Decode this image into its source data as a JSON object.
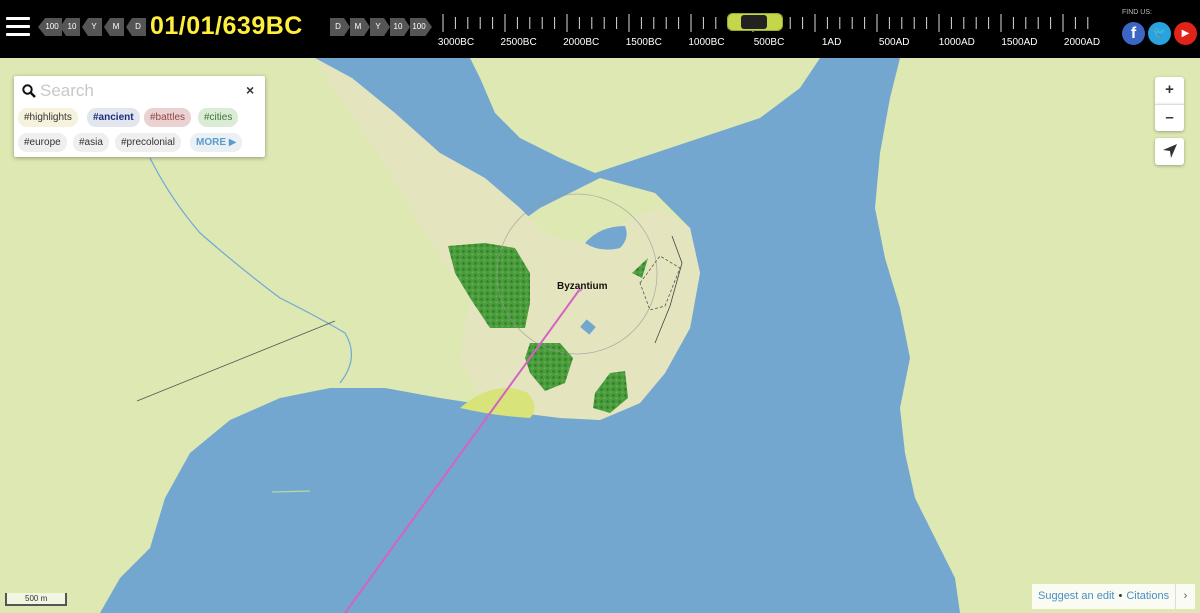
{
  "header": {
    "date": "01/01/639BC",
    "back_steps": [
      "100",
      "10",
      "Y",
      "M",
      "D"
    ],
    "forward_steps": [
      "D",
      "M",
      "Y",
      "10",
      "100"
    ],
    "timeline_labels": [
      "3000BC",
      "2500BC",
      "2000BC",
      "1500BC",
      "1000BC",
      "500BC",
      "1AD",
      "500AD",
      "1000AD",
      "1500AD",
      "2000AD"
    ],
    "find_us": "FIND US:",
    "social": {
      "facebook": "f",
      "twitter": "🐦",
      "youtube": "▶"
    }
  },
  "search": {
    "placeholder": "Search",
    "close": "×",
    "tags": [
      "#highlights",
      "#ancient",
      "#battles",
      "#cities",
      "#europe",
      "#asia",
      "#precolonial"
    ],
    "more": "MORE ▶"
  },
  "map": {
    "place_label": "Byzantium",
    "scale": "500 m",
    "controls": {
      "zoom_in": "+",
      "zoom_out": "–",
      "locate": "locate-arrow-icon"
    },
    "colors": {
      "water": "#74a7d0",
      "land": "#dde8b3",
      "city": "#e4e5bf",
      "forest": "#4b9c3c",
      "route": "#d363c4"
    }
  },
  "footer": {
    "suggest": "Suggest an edit",
    "separator": "•",
    "citations": "Citations",
    "arrow": "›"
  }
}
